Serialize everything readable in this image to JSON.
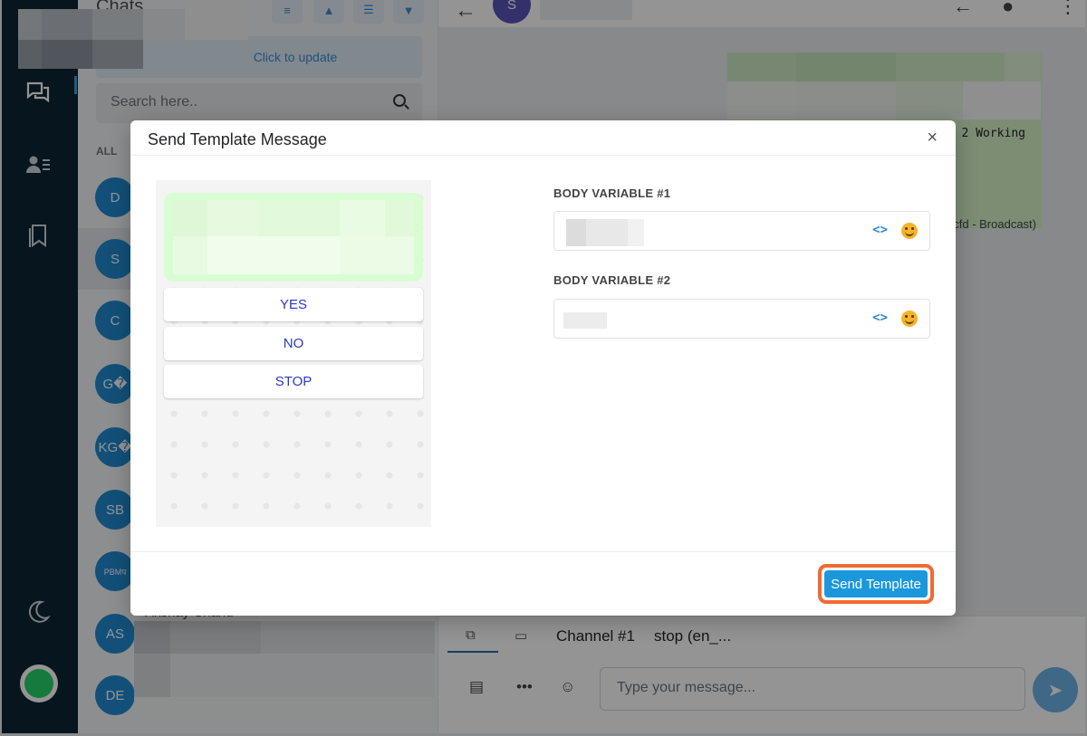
{
  "sidebar": {
    "header_title": "Chats",
    "update_text": "Click to update",
    "search_placeholder": "Search here..",
    "filter_label": "ALL",
    "contacts": [
      {
        "initials": "D"
      },
      {
        "initials": "S"
      },
      {
        "initials": "C"
      },
      {
        "initials": "G�"
      },
      {
        "initials": "KG�"
      },
      {
        "initials": "SB"
      },
      {
        "initials": "PBMप"
      },
      {
        "initials": "AS",
        "name_partial": "Akshay Chand"
      },
      {
        "initials": "DE"
      }
    ]
  },
  "chat": {
    "avatar_initial": "S",
    "message_text_partial": "2 Working",
    "broadcast_text_partial": "cfd - Broadcast)",
    "compose": {
      "channel_label": "Channel #1",
      "template_label": "stop (en_...",
      "message_placeholder": "Type your message..."
    }
  },
  "modal": {
    "title": "Send Template Message",
    "close_label": "×",
    "quick_replies": [
      "YES",
      "NO",
      "STOP"
    ],
    "body_variables": [
      {
        "label": "BODY VARIABLE #1",
        "code_icon": "<>"
      },
      {
        "label": "BODY VARIABLE #2",
        "code_icon": "<>"
      }
    ],
    "send_button_label": "Send Template"
  },
  "colors": {
    "accent": "#1b98dc",
    "highlight_ring": "#f06a35",
    "quick_reply_text": "#2a38c8",
    "bubble": "#d9fdd3"
  }
}
